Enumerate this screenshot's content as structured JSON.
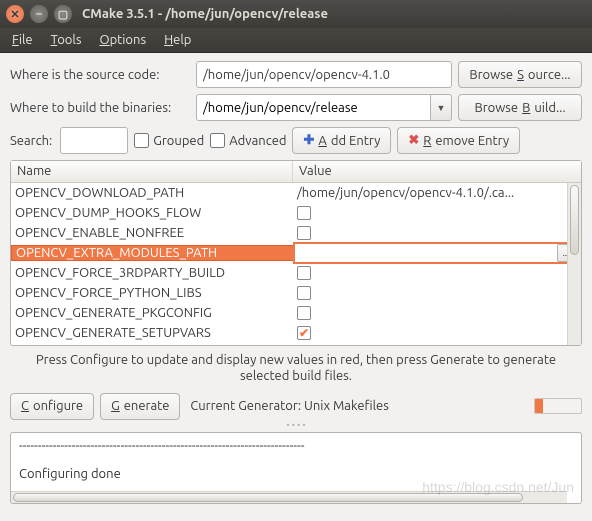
{
  "window": {
    "title": "CMake 3.5.1 - /home/jun/opencv/release"
  },
  "menu": {
    "file": "File",
    "tools": "Tools",
    "options": "Options",
    "help": "Help"
  },
  "paths": {
    "source_label": "Where is the source code:",
    "source_value": "/home/jun/opencv/opencv-4.1.0",
    "build_label": "Where to build the binaries:",
    "build_value": "/home/jun/opencv/release",
    "browse_source": "Browse Source...",
    "browse_build": "Browse Build..."
  },
  "toolbar": {
    "search_label": "Search:",
    "search_value": "",
    "grouped_label": "Grouped",
    "advanced_label": "Advanced",
    "add_entry_label": "Add Entry",
    "remove_entry_label": "Remove Entry"
  },
  "table": {
    "header_name": "Name",
    "header_value": "Value",
    "rows": [
      {
        "name": "OPENCV_DOWNLOAD_PATH",
        "value": "/home/jun/opencv/opencv-4.1.0/.ca...",
        "type": "text",
        "selected": false
      },
      {
        "name": "OPENCV_DUMP_HOOKS_FLOW",
        "value": "",
        "type": "bool",
        "checked": false,
        "selected": false
      },
      {
        "name": "OPENCV_ENABLE_NONFREE",
        "value": "",
        "type": "bool",
        "checked": false,
        "selected": false
      },
      {
        "name": "OPENCV_EXTRA_MODULES_PATH",
        "value": "",
        "type": "path",
        "selected": true
      },
      {
        "name": "OPENCV_FORCE_3RDPARTY_BUILD",
        "value": "",
        "type": "bool",
        "checked": false,
        "selected": false
      },
      {
        "name": "OPENCV_FORCE_PYTHON_LIBS",
        "value": "",
        "type": "bool",
        "checked": false,
        "selected": false
      },
      {
        "name": "OPENCV_GENERATE_PKGCONFIG",
        "value": "",
        "type": "bool",
        "checked": false,
        "selected": false
      },
      {
        "name": "OPENCV_GENERATE_SETUPVARS",
        "value": "",
        "type": "bool",
        "checked": true,
        "selected": false
      }
    ]
  },
  "hint": "Press Configure to update and display new values in red, then press Generate to generate selected build files.",
  "bottom": {
    "configure": "Configure",
    "generate": "Generate",
    "generator_label": "Current Generator: Unix Makefiles"
  },
  "output": {
    "line1": "----------------------------------------------------------------------------",
    "line2": "",
    "line3": "Configuring done"
  },
  "watermark": "https://blog.csdn.net/Jun"
}
